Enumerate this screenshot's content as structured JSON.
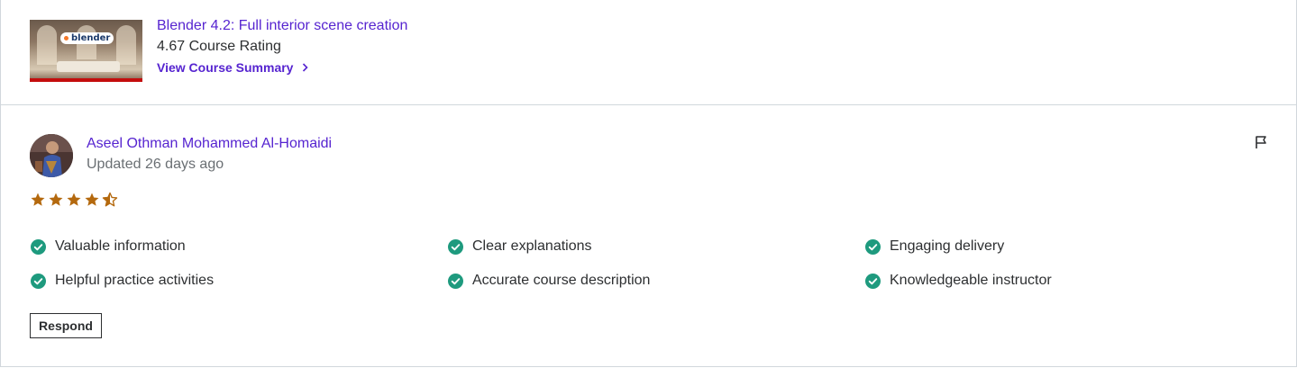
{
  "course": {
    "title": "Blender 4.2: Full interior scene creation",
    "rating_text": "4.67 Course Rating",
    "summary_link": "View Course Summary",
    "thumbnail_logo_text": "blender"
  },
  "review": {
    "reviewer_name": "Aseel Othman Mohammed Al-Homaidi",
    "updated": "Updated 26 days ago",
    "rating": 4.5,
    "rating_max": 5,
    "tags": [
      "Valuable information",
      "Clear explanations",
      "Engaging delivery",
      "Helpful practice activities",
      "Accurate course description",
      "Knowledgeable instructor"
    ],
    "respond_label": "Respond"
  },
  "icons": {
    "chevron": "chevron-right-icon",
    "flag": "flag-icon",
    "check": "check-circle-icon",
    "star": "star-icon"
  },
  "colors": {
    "brand_purple": "#5624d0",
    "star_orange": "#b4690e",
    "check_green": "#1e9a7e",
    "text_dark": "#2d2f31",
    "text_muted": "#6a6f73",
    "border": "#d1d7dc"
  }
}
